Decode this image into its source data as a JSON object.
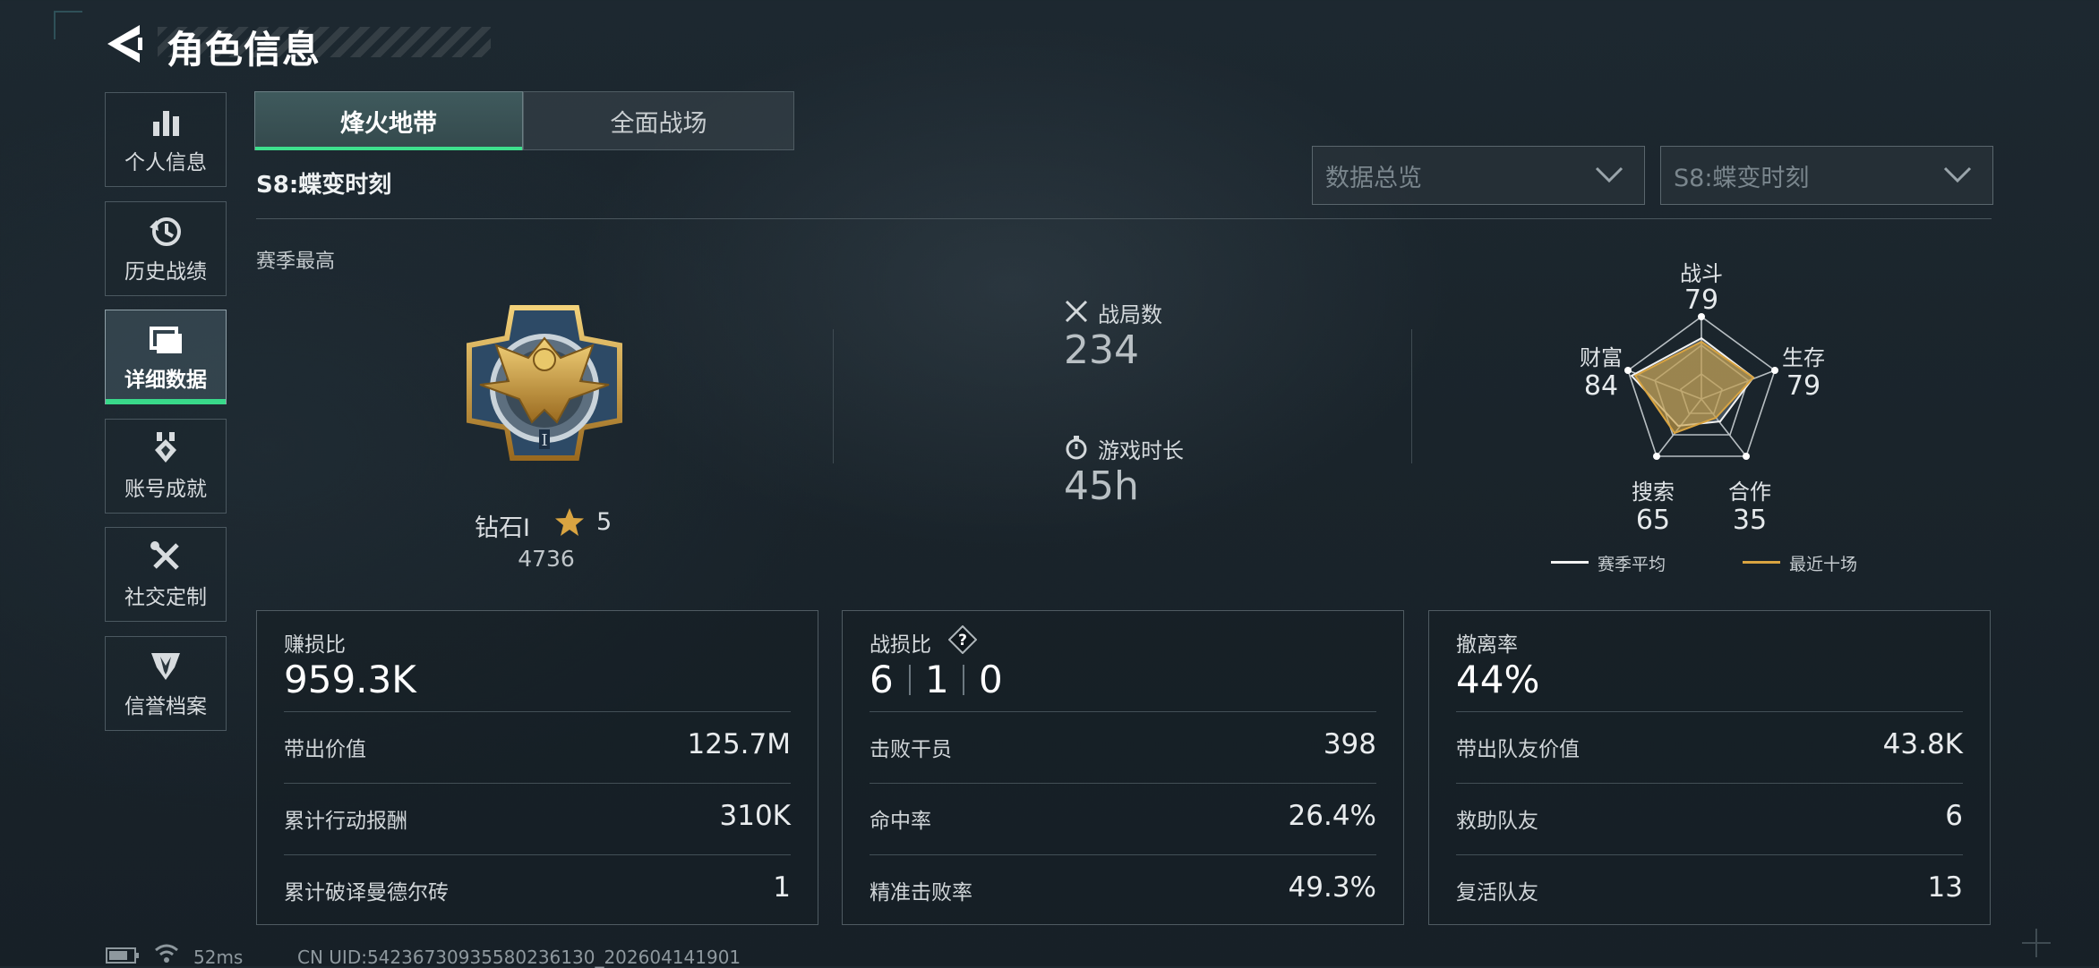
{
  "header": {
    "title": "角色信息"
  },
  "sidebar": {
    "items": [
      {
        "label": "个人信息",
        "icon": "bar-chart-icon"
      },
      {
        "label": "历史战绩",
        "icon": "history-icon"
      },
      {
        "label": "详细数据",
        "icon": "folder-icon",
        "active": true
      },
      {
        "label": "账号成就",
        "icon": "medal-icon"
      },
      {
        "label": "社交定制",
        "icon": "tools-icon"
      },
      {
        "label": "信誉档案",
        "icon": "emblem-icon"
      }
    ]
  },
  "tabs": [
    {
      "label": "烽火地带",
      "active": true
    },
    {
      "label": "全面战场",
      "active": false
    }
  ],
  "season": {
    "title": "S8:蝶变时刻",
    "best_label": "赛季最高"
  },
  "filters": {
    "view": {
      "value": "数据总览"
    },
    "season": {
      "value": "S8:蝶变时刻"
    }
  },
  "rank": {
    "name": "钻石Ⅰ",
    "stars": "5",
    "score": "4736"
  },
  "stats": {
    "matches": {
      "label": "战局数",
      "value": "234"
    },
    "playtime": {
      "label": "游戏时长",
      "value": "45h"
    }
  },
  "radar": {
    "axes": [
      {
        "label": "战斗",
        "value": "79"
      },
      {
        "label": "生存",
        "value": "79"
      },
      {
        "label": "合作",
        "value": "35"
      },
      {
        "label": "搜索",
        "value": "65"
      },
      {
        "label": "财富",
        "value": "84"
      }
    ],
    "legend": [
      {
        "label": "赛季平均",
        "color": "#f2f2f2"
      },
      {
        "label": "最近十场",
        "color": "#d9a441"
      }
    ]
  },
  "panels": {
    "profit": {
      "title": "赚损比",
      "value": "959.3K",
      "rows": [
        {
          "label": "带出价值",
          "value": "125.7M"
        },
        {
          "label": "累计行动报酬",
          "value": "310K"
        },
        {
          "label": "累计破译曼德尔砖",
          "value": "1"
        }
      ]
    },
    "kd": {
      "title": "战损比",
      "help": "?",
      "values": [
        "6",
        "1",
        "0"
      ],
      "rows": [
        {
          "label": "击败干员",
          "value": "398"
        },
        {
          "label": "命中率",
          "value": "26.4%"
        },
        {
          "label": "精准击败率",
          "value": "49.3%"
        }
      ]
    },
    "extract": {
      "title": "撤离率",
      "value": "44%",
      "rows": [
        {
          "label": "带出队友价值",
          "value": "43.8K"
        },
        {
          "label": "救助队友",
          "value": "6"
        },
        {
          "label": "复活队友",
          "value": "13"
        }
      ]
    }
  },
  "footer": {
    "ping": "52ms",
    "uid": "CN UID:54236730935580236130_202604141901"
  },
  "colors": {
    "accent": "#3ee08d",
    "rank_gold": "#d9a441"
  }
}
